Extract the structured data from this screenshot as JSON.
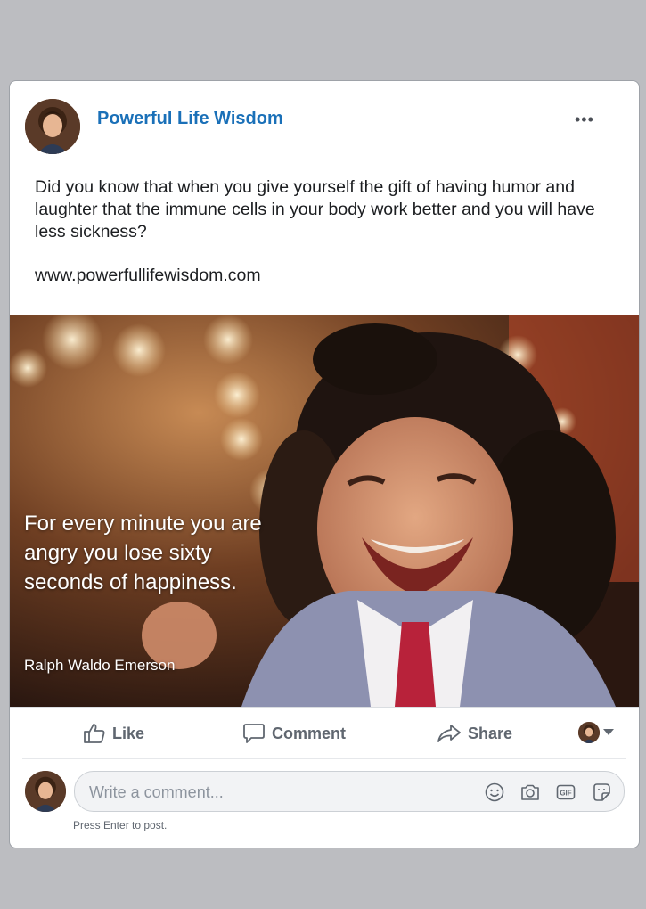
{
  "post": {
    "page_name": "Powerful Life Wisdom",
    "more_label": "•••",
    "text": "Did you know that when you give yourself the gift of having humor and laughter that the immune cells in your body work better and you will have less sickness?",
    "link": "www.powerfullifewisdom.com"
  },
  "media": {
    "quote": "For every minute you are angry you lose sixty seconds of happiness.",
    "author": "Ralph Waldo Emerson"
  },
  "actions": {
    "like_label": "Like",
    "comment_label": "Comment",
    "share_label": "Share"
  },
  "comment": {
    "placeholder": "Write a comment...",
    "value": "",
    "hint": "Press Enter to post."
  },
  "icons": {
    "more": "more-options-icon",
    "like": "thumbs-up-icon",
    "comment": "speech-bubble-icon",
    "share": "share-arrow-icon",
    "audience": "chevron-down-icon",
    "emoji": "smiley-icon",
    "camera": "camera-icon",
    "gif": "gif-icon",
    "sticker": "sticker-icon"
  },
  "colors": {
    "page_name": "#1a70b8",
    "action_text": "#606770",
    "background": "#bcbdc1"
  }
}
